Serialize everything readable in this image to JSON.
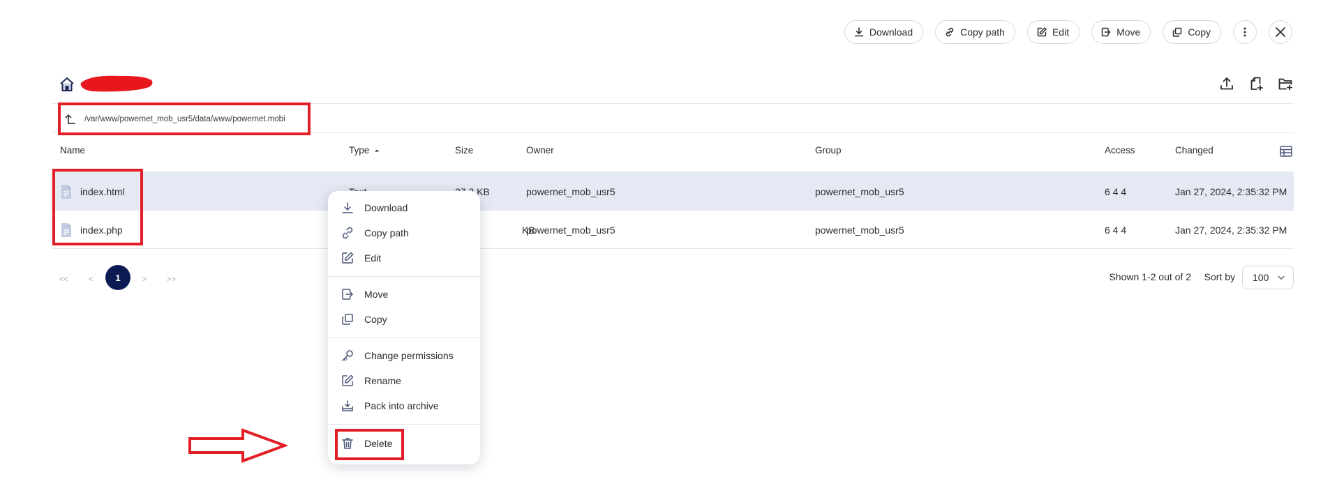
{
  "toolbar": {
    "download_label": "Download",
    "copy_path_label": "Copy path",
    "edit_label": "Edit",
    "move_label": "Move",
    "copy_label": "Copy"
  },
  "path": "/var/www/powernet_mob_usr5/data/www/powernet.mobi",
  "table": {
    "headers": {
      "name": "Name",
      "type": "Type",
      "size": "Size",
      "owner": "Owner",
      "group": "Group",
      "access": "Access",
      "changed": "Changed"
    },
    "rows": [
      {
        "name": "index.html",
        "type": "Text",
        "size": "27.3 KB",
        "owner": "powernet_mob_usr5",
        "group": "powernet_mob_usr5",
        "access": "6 4 4",
        "changed": "Jan 27, 2024, 2:35:32 PM"
      },
      {
        "name": "index.php",
        "type": "",
        "size": "KB",
        "owner": "powernet_mob_usr5",
        "group": "powernet_mob_usr5",
        "access": "6 4 4",
        "changed": "Jan 27, 2024, 2:35:32 PM"
      }
    ]
  },
  "pagination": {
    "first": "<<",
    "prev": "<",
    "current": "1",
    "next": ">",
    "last": ">>",
    "shown": "Shown 1-2 out of 2",
    "sort_by_label": "Sort by",
    "page_size": "100"
  },
  "context_menu": {
    "download": "Download",
    "copy_path": "Copy path",
    "edit": "Edit",
    "move": "Move",
    "copy": "Copy",
    "change_permissions": "Change permissions",
    "rename": "Rename",
    "pack": "Pack into archive",
    "delete": "Delete"
  },
  "colors": {
    "accent": "#0c1a54",
    "highlight": "#e21f26",
    "selected_row": "#e4e9f3"
  }
}
